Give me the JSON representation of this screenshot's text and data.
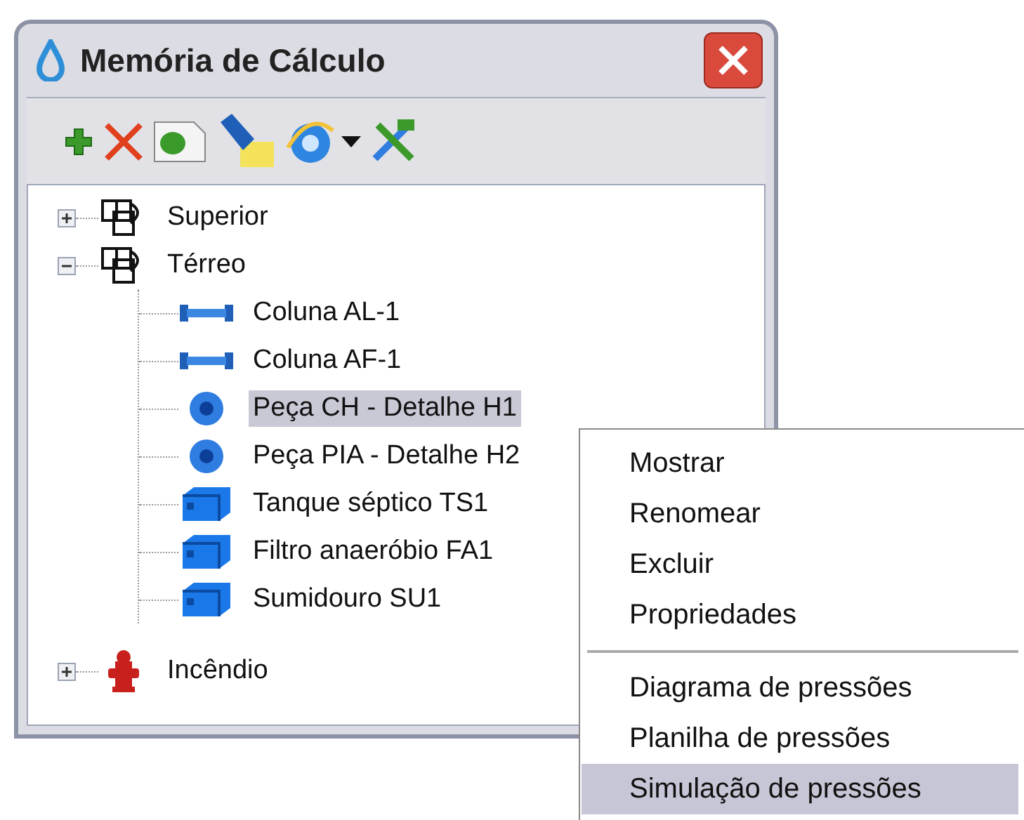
{
  "window": {
    "title": "Memória de Cálculo"
  },
  "toolbar": [
    {
      "kind": "add"
    },
    {
      "kind": "delete"
    },
    {
      "kind": "document"
    },
    {
      "kind": "flashlight"
    },
    {
      "kind": "browser",
      "dropdown": true
    },
    {
      "kind": "tools"
    }
  ],
  "tree": [
    {
      "label": "Superior",
      "kind": "floor",
      "expanded": false,
      "selected": false
    },
    {
      "label": "Térreo",
      "kind": "floor",
      "expanded": true,
      "selected": false,
      "children": [
        {
          "label": "Coluna AL-1",
          "kind": "column",
          "selected": false
        },
        {
          "label": "Coluna AF-1",
          "kind": "column",
          "selected": false
        },
        {
          "label": "Peça CH - Detalhe H1",
          "kind": "fixture",
          "selected": true
        },
        {
          "label": "Peça PIA - Detalhe H2",
          "kind": "fixture",
          "selected": false
        },
        {
          "label": "Tanque séptico TS1",
          "kind": "tank",
          "selected": false
        },
        {
          "label": "Filtro anaeróbio FA1",
          "kind": "tank",
          "selected": false
        },
        {
          "label": "Sumidouro SU1",
          "kind": "tank",
          "selected": false
        }
      ]
    },
    {
      "label": "Incêndio",
      "kind": "hydrant",
      "expanded": false,
      "selected": false
    }
  ],
  "context_menu": [
    {
      "kind": "item",
      "label": "Mostrar",
      "selected": false
    },
    {
      "kind": "item",
      "label": "Renomear",
      "selected": false
    },
    {
      "kind": "item",
      "label": "Excluir",
      "selected": false
    },
    {
      "kind": "item",
      "label": "Propriedades",
      "selected": false
    },
    {
      "kind": "separator"
    },
    {
      "kind": "item",
      "label": "Diagrama de pressões",
      "selected": false
    },
    {
      "kind": "item",
      "label": "Planilha de pressões",
      "selected": false
    },
    {
      "kind": "item",
      "label": "Simulação de pressões",
      "selected": true
    }
  ]
}
